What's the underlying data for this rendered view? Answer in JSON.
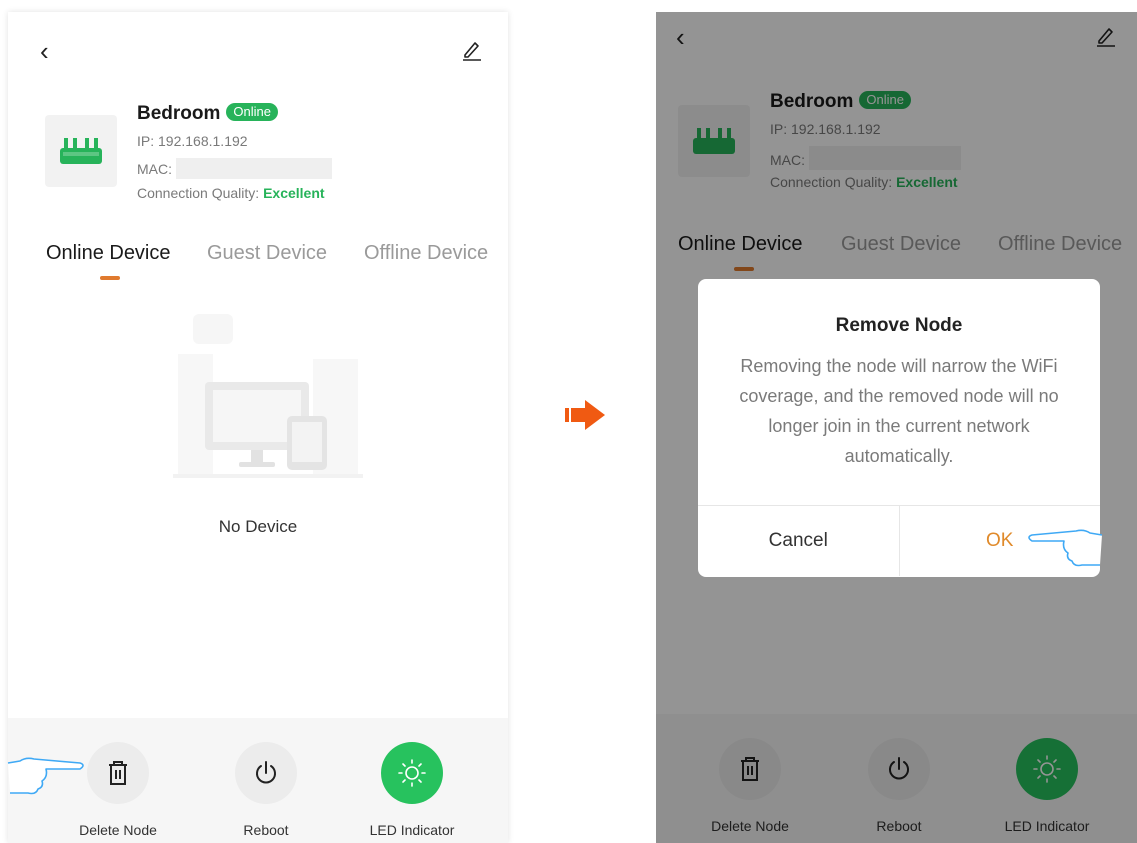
{
  "colors": {
    "online_green": "#27b35a",
    "led_green": "#27c25e",
    "tab_underline": "#e07a2e",
    "ok_orange": "#e08a2a",
    "step_arrow": "#f05a12",
    "hand_outline": "#3fa9f5"
  },
  "left_screen": {
    "back_icon": "chevron-left-icon",
    "edit_icon": "pencil-icon",
    "device": {
      "name": "Bedroom",
      "status": "Online",
      "ip_label": "IP:",
      "ip": "192.168.1.192",
      "mac_label": "MAC:",
      "quality_label": "Connection Quality:",
      "quality": "Excellent"
    },
    "tabs": [
      "Online Device",
      "Guest Device",
      "Offline Device"
    ],
    "active_tab": 0,
    "empty_text": "No Device",
    "actions": [
      "Delete Node",
      "Reboot",
      "LED Indicator"
    ]
  },
  "right_screen": {
    "device": {
      "name": "Bedroom",
      "status": "Online",
      "ip_label": "IP:",
      "ip": "192.168.1.192",
      "mac_label": "MAC:",
      "quality_label": "Connection Quality:",
      "quality": "Excellent"
    },
    "tabs": [
      "Online Device",
      "Guest Device",
      "Offline Device"
    ],
    "dialog": {
      "title": "Remove Node",
      "message": "Removing the node will narrow the WiFi coverage, and the removed node will no longer join in the current network automatically.",
      "cancel_label": "Cancel",
      "ok_label": "OK"
    },
    "actions": [
      "Delete Node",
      "Reboot",
      "LED Indicator"
    ]
  }
}
